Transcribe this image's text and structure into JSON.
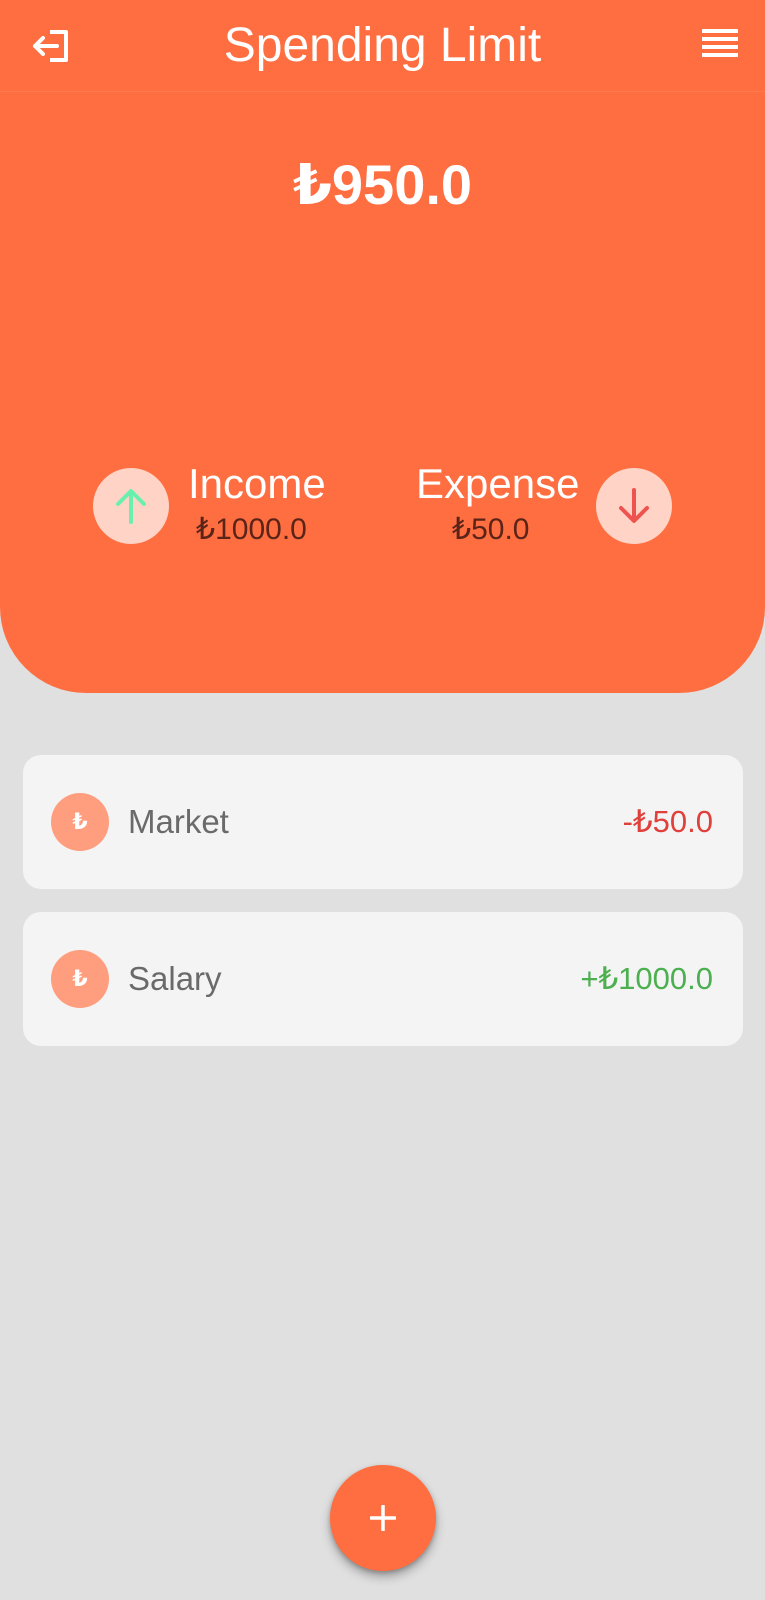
{
  "header": {
    "title": "Spending Limit",
    "logout_icon": "logout-icon",
    "menu_icon": "list-menu-icon",
    "balance": "₺950.0"
  },
  "summary": {
    "income": {
      "label": "Income",
      "value": "₺1000.0",
      "icon": "arrow-up-icon",
      "icon_color": "#69f0ae"
    },
    "expense": {
      "label": "Expense",
      "value": "₺50.0",
      "icon": "arrow-down-icon",
      "icon_color": "#ef5350"
    }
  },
  "transactions": [
    {
      "name": "Market",
      "amount": "-₺50.0",
      "icon_text": "₺",
      "type": "expense"
    },
    {
      "name": "Salary",
      "amount": "+₺1000.0",
      "icon_text": "₺",
      "type": "income"
    }
  ],
  "fab": {
    "icon": "plus-icon"
  },
  "colors": {
    "primary": "#ff6e40",
    "background": "#e0e0e0",
    "card": "#f4f4f4",
    "negative": "#e0403a",
    "positive": "#4caf50"
  }
}
